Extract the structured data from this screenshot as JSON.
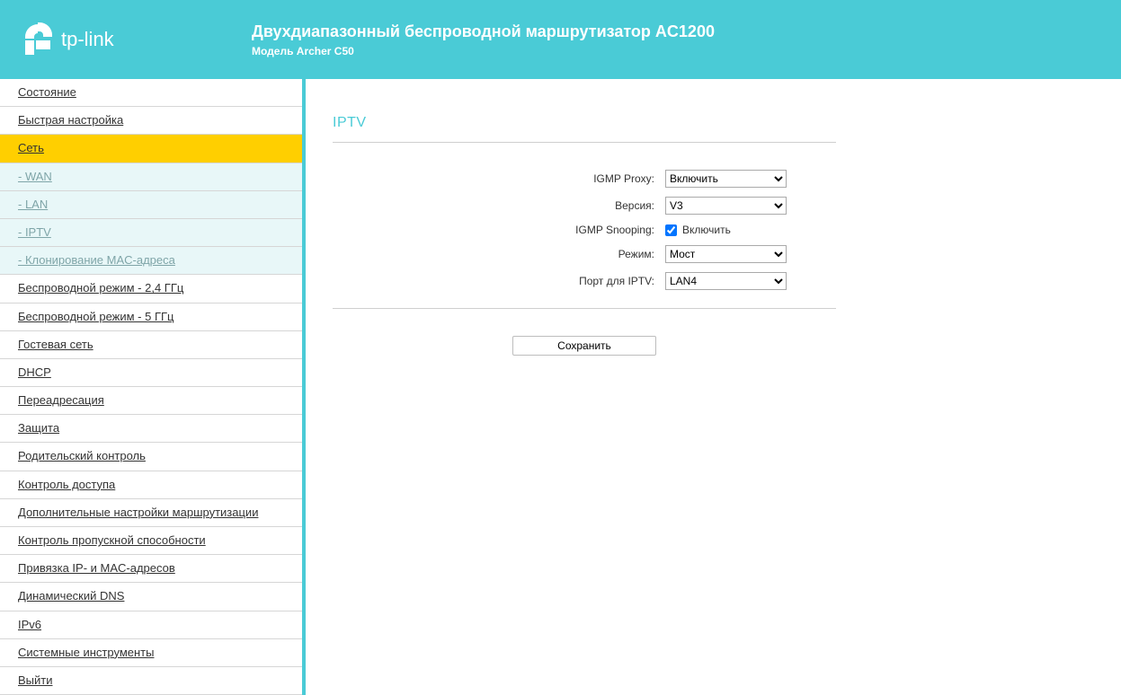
{
  "brand": "tp-link",
  "header": {
    "title": "Двухдиапазонный беспроводной маршрутизатор AC1200",
    "subtitle": "Модель Archer C50"
  },
  "sidebar": {
    "items": [
      {
        "label": "Состояние",
        "type": "item"
      },
      {
        "label": "Быстрая настройка",
        "type": "item"
      },
      {
        "label": "Сеть",
        "type": "item",
        "active": true
      },
      {
        "label": "- WAN",
        "type": "sub"
      },
      {
        "label": "- LAN",
        "type": "sub"
      },
      {
        "label": "- IPTV",
        "type": "sub",
        "current": true
      },
      {
        "label": "- Клонирование MAC-адреса",
        "type": "sub"
      },
      {
        "label": "Беспроводной режим - 2,4 ГГц",
        "type": "item"
      },
      {
        "label": "Беспроводной режим - 5 ГГц",
        "type": "item"
      },
      {
        "label": "Гостевая сеть",
        "type": "item"
      },
      {
        "label": "DHCP",
        "type": "item"
      },
      {
        "label": "Переадресация",
        "type": "item"
      },
      {
        "label": "Защита",
        "type": "item"
      },
      {
        "label": "Родительский контроль",
        "type": "item"
      },
      {
        "label": "Контроль доступа",
        "type": "item"
      },
      {
        "label": "Дополнительные настройки маршрутизации",
        "type": "item"
      },
      {
        "label": "Контроль пропускной способности",
        "type": "item"
      },
      {
        "label": "Привязка IP- и MAC-адресов",
        "type": "item"
      },
      {
        "label": "Динамический DNS",
        "type": "item"
      },
      {
        "label": "IPv6",
        "type": "item"
      },
      {
        "label": "Системные инструменты",
        "type": "item"
      },
      {
        "label": "Выйти",
        "type": "item"
      }
    ]
  },
  "page": {
    "title": "IPTV",
    "form": {
      "igmp_proxy": {
        "label": "IGMP Proxy:",
        "value": "Включить"
      },
      "version": {
        "label": "Версия:",
        "value": "V3"
      },
      "igmp_snooping": {
        "label": "IGMP Snooping:",
        "checkbox_label": "Включить",
        "checked": true
      },
      "mode": {
        "label": "Режим:",
        "value": "Мост"
      },
      "iptv_port": {
        "label": "Порт для IPTV:",
        "value": "LAN4"
      }
    },
    "save_button": "Сохранить"
  }
}
